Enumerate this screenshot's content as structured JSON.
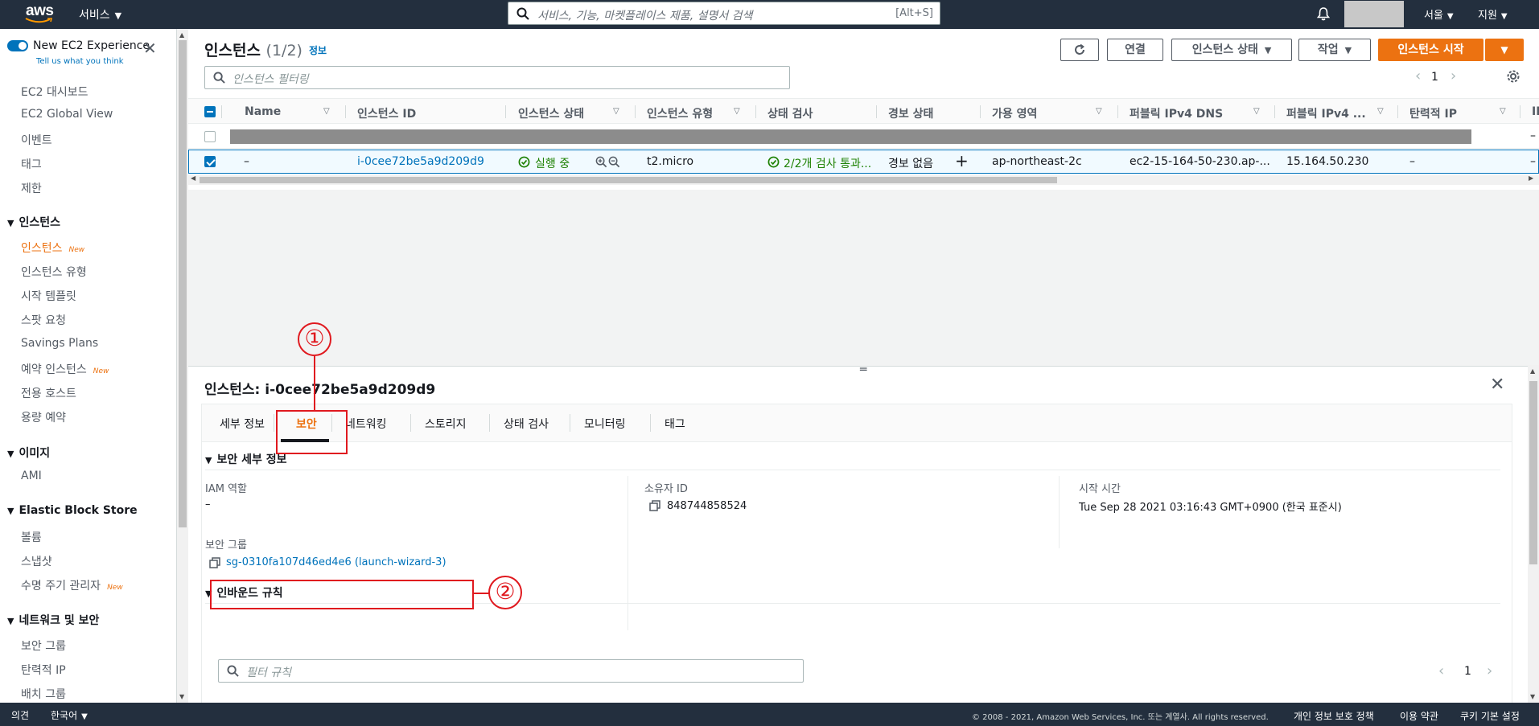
{
  "topnav": {
    "logo_text": "aws",
    "services_label": "서비스",
    "search_placeholder": "서비스, 기능, 마켓플레이스 제품, 설명서 검색",
    "search_shortcut": "[Alt+S]",
    "region_label": "서울",
    "support_label": "지원"
  },
  "sidebar": {
    "new_experience": {
      "title": "New EC2 Experience",
      "subtitle": "Tell us what you think"
    },
    "top_items": [
      "EC2 대시보드",
      "EC2 Global View",
      "이벤트",
      "태그",
      "제한"
    ],
    "sections": [
      {
        "title": "인스턴스",
        "items": [
          {
            "label": "인스턴스",
            "badge": "New",
            "active": true
          },
          {
            "label": "인스턴스 유형"
          },
          {
            "label": "시작 템플릿"
          },
          {
            "label": "스팟 요청"
          },
          {
            "label": "Savings Plans"
          },
          {
            "label": "예약 인스턴스",
            "badge": "New"
          },
          {
            "label": "전용 호스트"
          },
          {
            "label": "용량 예약"
          }
        ]
      },
      {
        "title": "이미지",
        "items": [
          {
            "label": "AMI"
          }
        ]
      },
      {
        "title": "Elastic Block Store",
        "items": [
          {
            "label": "볼륨"
          },
          {
            "label": "스냅샷"
          },
          {
            "label": "수명 주기 관리자",
            "badge": "New"
          }
        ]
      },
      {
        "title": "네트워크 및 보안",
        "items": [
          {
            "label": "보안 그룹"
          },
          {
            "label": "탄력적 IP"
          },
          {
            "label": "배치 그룹"
          }
        ]
      }
    ]
  },
  "main": {
    "title": "인스턴스",
    "count": "(1/2)",
    "info_link": "정보",
    "buttons": {
      "connect": "연결",
      "instance_state": "인스턴스 상태",
      "actions": "작업",
      "launch": "인스턴스 시작"
    },
    "filter_placeholder": "인스턴스 필터링",
    "page_number": "1",
    "table": {
      "headers": [
        "Name",
        "인스턴스 ID",
        "인스턴스 상태",
        "인스턴스 유형",
        "상태 검사",
        "경보 상태",
        "가용 영역",
        "퍼블릭 IPv4 DNS",
        "퍼블릭 IPv4 ...",
        "탄력적 IP",
        "IP"
      ],
      "row1_trailing": "–",
      "selected_row": {
        "name": "–",
        "instance_id": "i-0cee72be5a9d209d9",
        "state": "실행 중",
        "type": "t2.micro",
        "status_check": "2/2개 검사 통과...",
        "alarm": "경보 없음",
        "az": "ap-northeast-2c",
        "dns": "ec2-15-164-50-230.ap-...",
        "ipv4": "15.164.50.230",
        "eip": "–",
        "trailing": "–"
      }
    }
  },
  "detail": {
    "title": "인스턴스: i-0cee72be5a9d209d9",
    "tabs": [
      "세부 정보",
      "보안",
      "네트워킹",
      "스토리지",
      "상태 검사",
      "모니터링",
      "태그"
    ],
    "active_tab": "보안",
    "section_title": "보안 세부 정보",
    "iam_label": "IAM 역할",
    "iam_value": "–",
    "owner_label": "소유자 ID",
    "owner_value": "848744858524",
    "launch_label": "시작 시간",
    "launch_value": "Tue Sep 28 2021 03:16:43 GMT+0900 (한국 표준시)",
    "sg_label": "보안 그룹",
    "sg_value": "sg-0310fa107d46ed4e6 (launch-wizard-3)",
    "inbound_title": "인바운드 규칙",
    "rules_filter_placeholder": "필터 규칙",
    "rules_page": "1"
  },
  "annotations": {
    "one": "①",
    "two": "②"
  },
  "footer": {
    "feedback": "의견",
    "language": "한국어",
    "copyright": "© 2008 - 2021, Amazon Web Services, Inc. 또는 계열사. All rights reserved.",
    "privacy": "개인 정보 보호 정책",
    "terms": "이용 약관",
    "cookies": "쿠키 기본 설정"
  },
  "colors": {
    "nav_bg": "#232f3e",
    "accent": "#ec7211",
    "link": "#0073bb",
    "success": "#1d8102",
    "annotation": "#e0191f"
  }
}
